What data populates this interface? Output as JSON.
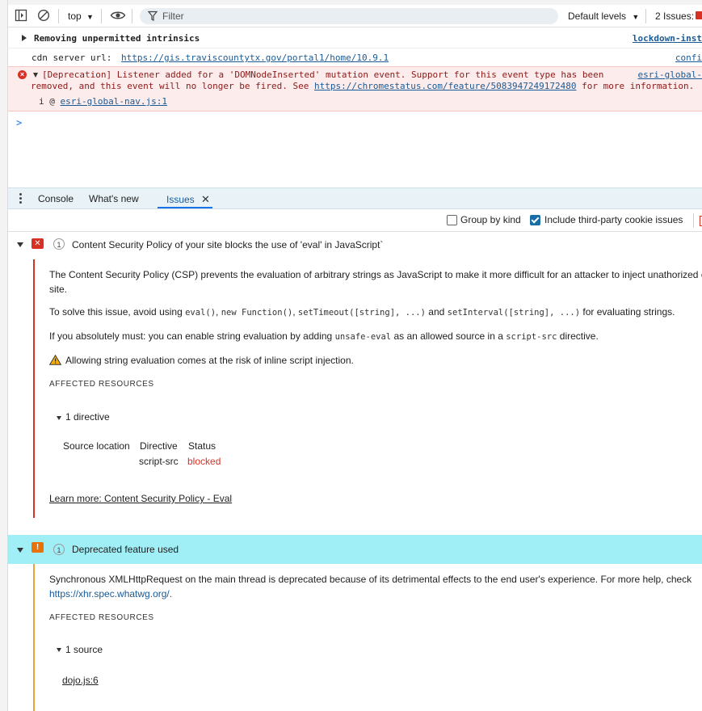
{
  "toolbar": {
    "context": "top",
    "filter_placeholder": "Filter",
    "levels": "Default levels",
    "issues": "2 Issues:"
  },
  "console": {
    "messages": [
      {
        "text": "Removing unpermitted intrinsics",
        "source": "lockdown-inst"
      },
      {
        "label": "cdn server url:",
        "url": "https://gis.traviscountytx.gov/portal1/home/10.9.1",
        "source": "confi"
      },
      {
        "line1": "[Deprecation] Listener added for a 'DOMNodeInserted' mutation event. Support for this event type has been",
        "line2_pre": "removed, and this event will no longer be fired. See",
        "line2_link": "https://chromestatus.com/feature/5083947249172480",
        "line2_post": "for more information.",
        "source": "esri-global-",
        "stack_prefix": "i @",
        "stack_link": "esri-global-nav.js:1"
      }
    ],
    "prompt": ">"
  },
  "drawer": {
    "tabs": [
      {
        "label": "Console"
      },
      {
        "label": "What's new"
      },
      {
        "label": "Issues"
      }
    ]
  },
  "issues_toolbar": {
    "group_by_kind": "Group by kind",
    "include_third_party": "Include third-party cookie issues"
  },
  "issues": [
    {
      "count": "1",
      "title": "Content Security Policy of your site blocks the use of 'eval' in JavaScript`",
      "desc_line1": "The Content Security Policy (CSP) prevents the evaluation of arbitrary strings as JavaScript to make it more difficult for an attacker to inject unathorized co",
      "desc_line2": "site.",
      "solve_pre": "To solve this issue, avoid using",
      "solve_code1": "eval()",
      "solve_code2": "new Function()",
      "solve_code3": "setTimeout([string], ...)",
      "solve_and": "and",
      "solve_code4": "setInterval([string], ...)",
      "solve_post": "for evaluating strings.",
      "must_pre": "If you absolutely must: you can enable string evaluation by adding",
      "must_code1": "unsafe-eval",
      "must_mid": "as an allowed source in a",
      "must_code2": "script-src",
      "must_post": "directive.",
      "warning": "Allowing string evaluation comes at the risk of inline script injection.",
      "affected_heading": "AFFECTED RESOURCES",
      "directive_toggle": "1 directive",
      "table_headers": [
        "Source location",
        "Directive",
        "Status"
      ],
      "table_row": {
        "directive": "script-src",
        "status": "blocked"
      },
      "learn_more": "Learn more: Content Security Policy - Eval"
    },
    {
      "count": "1",
      "title": "Deprecated feature used",
      "desc_line1": "Synchronous XMLHttpRequest on the main thread is deprecated because of its detrimental effects to the end user's experience. For more help, check",
      "desc_link": "https://xhr.spec.whatwg.org/.",
      "affected_heading": "AFFECTED RESOURCES",
      "source_toggle": "1 source",
      "source_link": "dojo.js:6"
    }
  ],
  "colors": {
    "error_red": "#d93025",
    "warning_orange": "#e8710a",
    "selected_row": "#a0eef6",
    "link_blue": "#1a5a96"
  }
}
